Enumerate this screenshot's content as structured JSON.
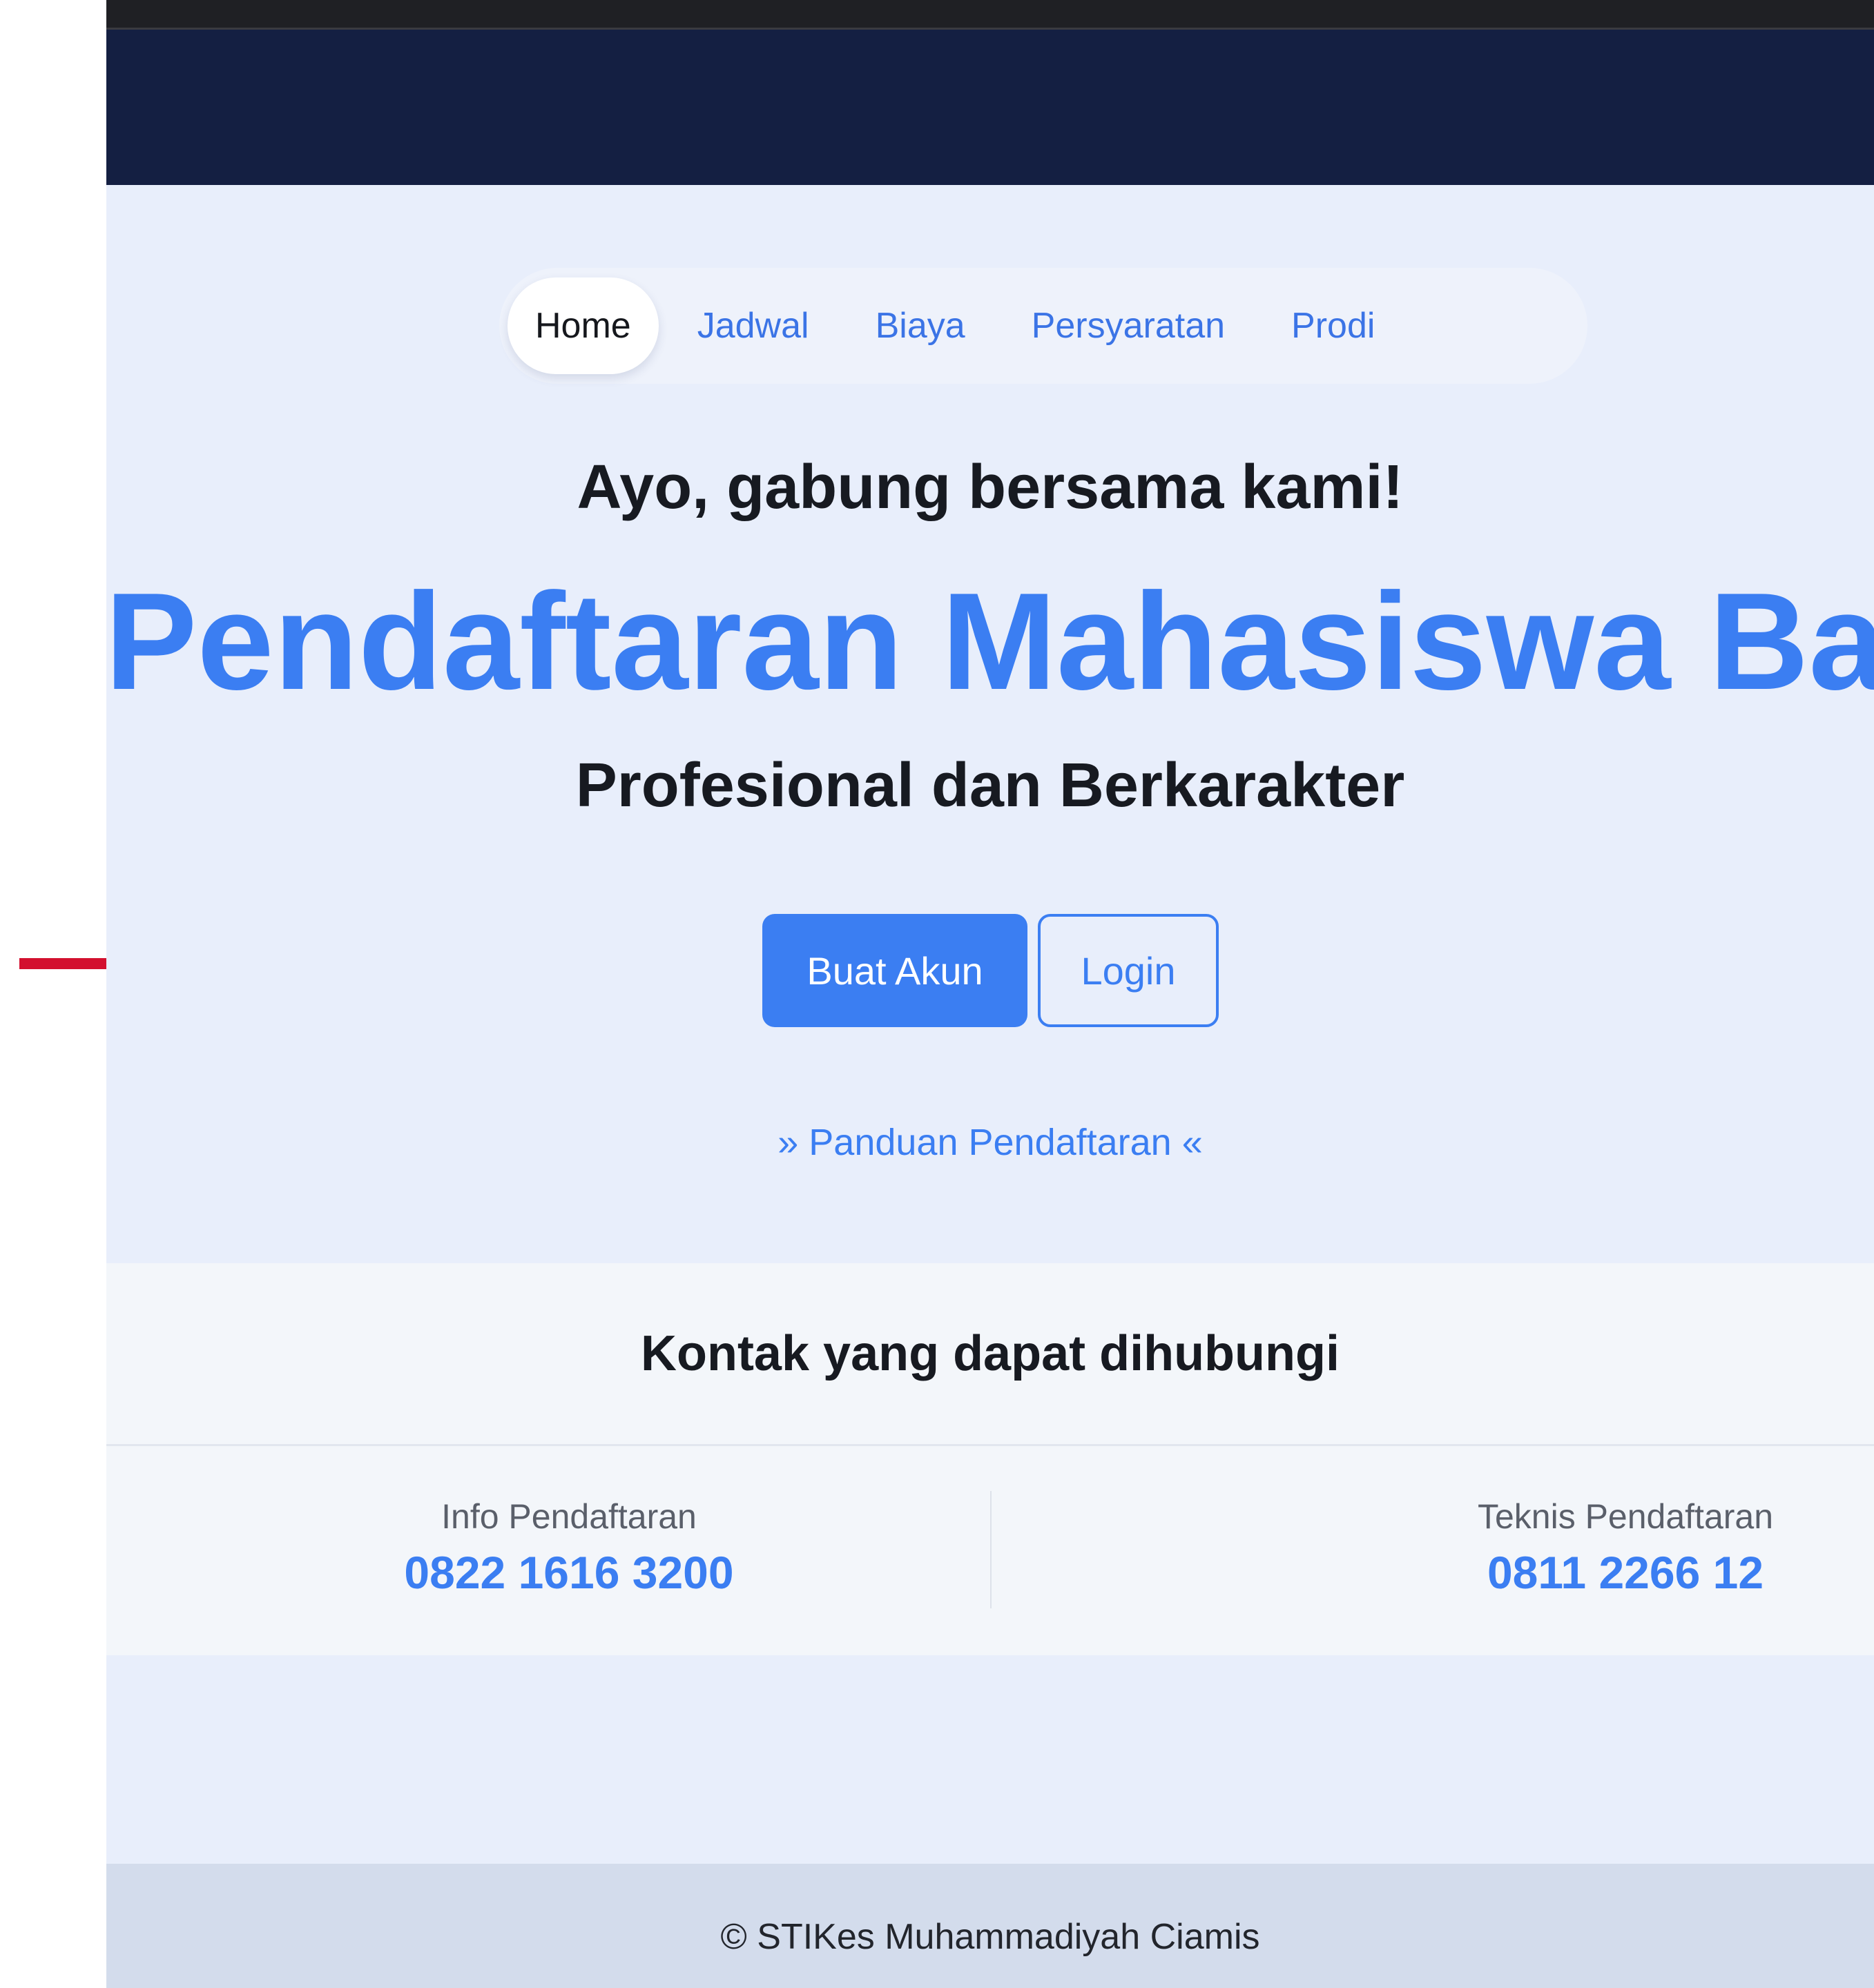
{
  "nav": {
    "items": [
      {
        "label": "Home",
        "active": true
      },
      {
        "label": "Jadwal",
        "active": false
      },
      {
        "label": "Biaya",
        "active": false
      },
      {
        "label": "Persyaratan",
        "active": false
      },
      {
        "label": "Prodi",
        "active": false
      }
    ]
  },
  "hero": {
    "headline": "Ayo, gabung bersama kami!",
    "title": "Pendaftaran Mahasiswa Baru",
    "subtitle": "Profesional dan Berkarakter",
    "primary_button": "Buat Akun",
    "secondary_button": "Login",
    "guide_link": "» Panduan Pendaftaran «"
  },
  "contact": {
    "heading": "Kontak yang dapat dihubungi",
    "items": [
      {
        "label": "Info Pendaftaran",
        "number": "0822 1616 3200"
      },
      {
        "label": "Teknis Pendaftaran",
        "number": "0811 2266 12"
      }
    ]
  },
  "footer": {
    "text": "© STIKes Muhammadiyah Ciamis"
  },
  "colors": {
    "header_bg": "#141f42",
    "accent": "#3b7ef2",
    "annotation_arrow": "#d3102f"
  }
}
